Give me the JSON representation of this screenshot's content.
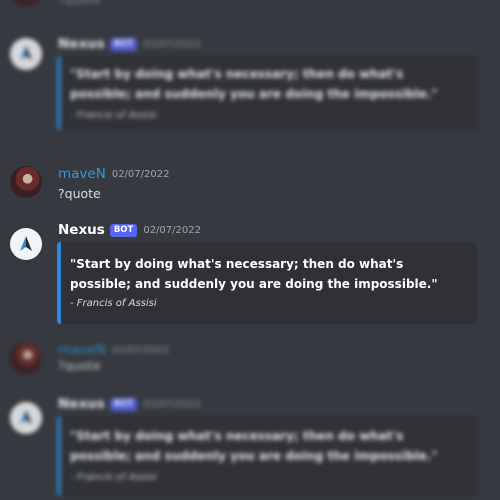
{
  "messages": [
    {
      "author": "maveN",
      "timestamp": "02/07/2022",
      "text": "?quote"
    },
    {
      "author": "Nexus",
      "badge": "BOT",
      "timestamp": "02/07/2022",
      "embed": {
        "quote": "\"Start by doing what's necessary; then do what's possible; and suddenly you are doing the impossible.\"",
        "author": "- Francis of Assisi"
      }
    }
  ],
  "colors": {
    "background": "#36393f",
    "embed_bg": "#2f3136",
    "embed_accent": "#2f88d8",
    "bot_badge": "#5865f2",
    "user_name": "#3498db"
  },
  "icons": {
    "bot_avatar": "nexus-logo-icon",
    "user_avatar": "anime-avatar"
  }
}
